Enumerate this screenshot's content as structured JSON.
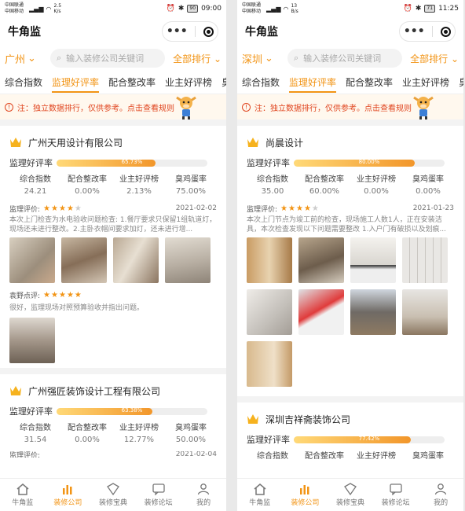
{
  "left": {
    "status": {
      "carrier1": "中国联通",
      "carrier2": "中国移动",
      "speed": "2.5",
      "speed_unit": "K/s",
      "battery": "90",
      "time": "09:00"
    },
    "app_title": "牛角监",
    "city": "广州",
    "search_placeholder": "输入装修公司关键词",
    "rank_label": "全部排行",
    "tabs": [
      "综合指数",
      "监理好评率",
      "配合整改率",
      "业主好评榜",
      "臭"
    ],
    "notice": "注：独立数据排行，仅供参考。点击查看规则",
    "cards": [
      {
        "name": "广州天用设计有限公司",
        "rating_label": "监理好评率",
        "rating_pct": 65.73,
        "rating_text": "65.73%",
        "stat_labels": [
          "综合指数",
          "配合整改率",
          "业主好评榜",
          "臭鸡蛋率"
        ],
        "stat_values": [
          "24.21",
          "0.00%",
          "2.13%",
          "75.00%"
        ],
        "eval_label": "监理评价:",
        "stars": 4,
        "date": "2021-02-02",
        "eval_text": "本次上门检查为水电验收问题检查: 1.餐厅要求只保留1组轨道灯，现场还未进行整改。2.主卧衣帽间要求加灯，还未进行增...",
        "reply_label": "袁野点评:",
        "reply_stars": 5,
        "reply_text": "很好，监理现场对照预算验收并指出问题。"
      },
      {
        "name": "广州强匠装饰设计工程有限公司",
        "rating_label": "监理好评率",
        "rating_pct": 63.38,
        "rating_text": "63.38%",
        "stat_labels": [
          "综合指数",
          "配合整改率",
          "业主好评榜",
          "臭鸡蛋率"
        ],
        "stat_values": [
          "31.54",
          "0.00%",
          "12.77%",
          "50.00%"
        ],
        "eval_label": "监理评价:",
        "date": "2021-02-04"
      }
    ]
  },
  "right": {
    "status": {
      "carrier1": "中国联通",
      "carrier2": "中国移动",
      "speed": "13",
      "speed_unit": "B/s",
      "battery": "71",
      "time": "11:25"
    },
    "app_title": "牛角监",
    "city": "深圳",
    "search_placeholder": "输入装修公司关键词",
    "rank_label": "全部排行",
    "tabs": [
      "综合指数",
      "监理好评率",
      "配合整改率",
      "业主好评榜",
      "臭"
    ],
    "notice": "注：独立数据排行，仅供参考。点击查看规则",
    "cards": [
      {
        "name": "尚晨设计",
        "rating_label": "监理好评率",
        "rating_pct": 80.0,
        "rating_text": "80.00%",
        "stat_labels": [
          "综合指数",
          "配合整改率",
          "业主好评榜",
          "臭鸡蛋率"
        ],
        "stat_values": [
          "35.00",
          "60.00%",
          "0.00%",
          "0.00%"
        ],
        "eval_label": "监理评价:",
        "stars": 4,
        "date": "2021-01-23",
        "eval_text": "本次上门节点为竣工前的检查，现场施工人数1人，正在安装洁具，本次检查发现以下问题需要整改 1.入户门有破损以及划痕..."
      },
      {
        "name": "深圳吉祥斋装饰公司",
        "rating_label": "监理好评率",
        "rating_pct": 77.42,
        "rating_text": "77.42%",
        "stat_labels": [
          "综合指数",
          "配合整改率",
          "业主好评榜",
          "臭鸡蛋率"
        ]
      }
    ]
  },
  "tabbar": [
    "牛角监",
    "装修公司",
    "装修宝典",
    "装修论坛",
    "我的"
  ],
  "tabbar_icons": [
    "home-icon",
    "company-icon",
    "vip-icon",
    "forum-icon",
    "user-icon"
  ],
  "colors": {
    "accent": "#f29415",
    "notice": "#e0451f"
  }
}
